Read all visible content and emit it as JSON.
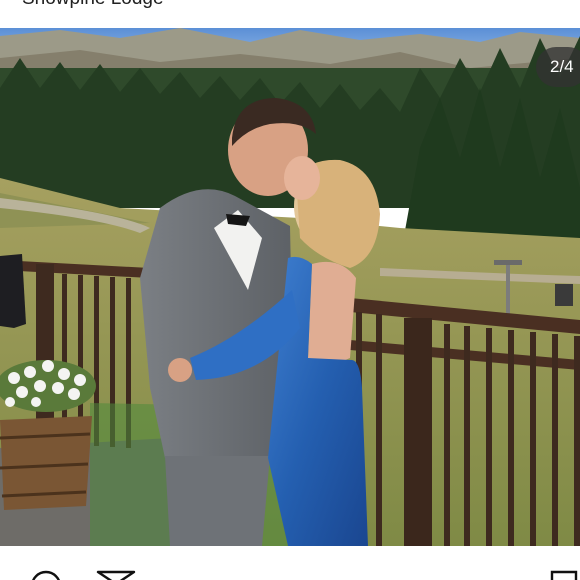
{
  "post": {
    "location": "Snowpine Lodge",
    "image_counter": "2/4"
  },
  "icons": {
    "comment": "comment-icon",
    "share": "share-icon",
    "save": "bookmark-icon"
  }
}
